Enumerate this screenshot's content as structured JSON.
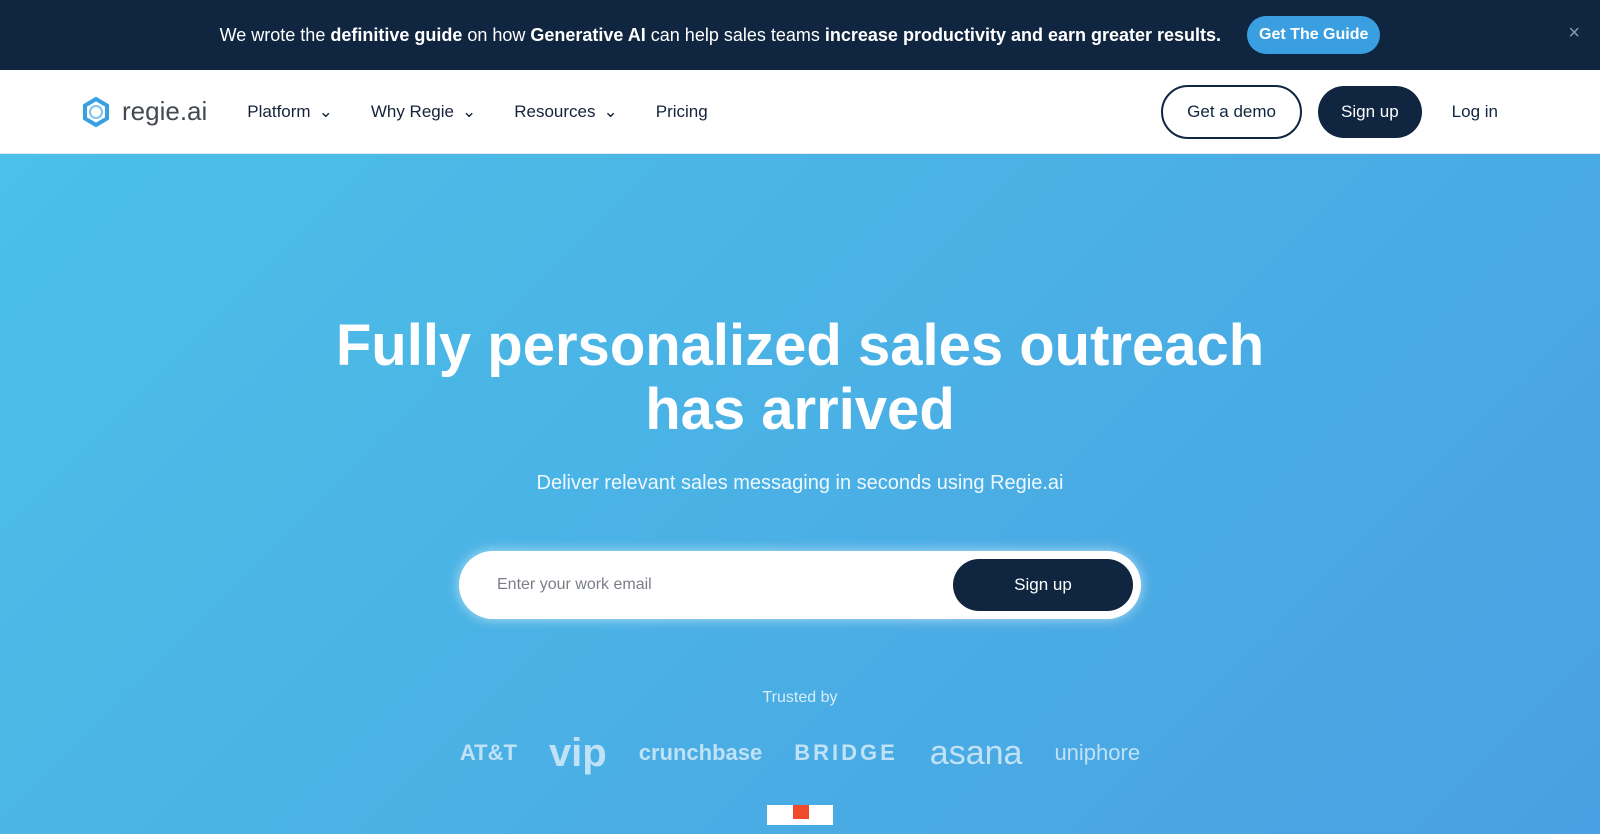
{
  "banner": {
    "pre": "We wrote the ",
    "b1": "definitive guide",
    "mid1": " on how ",
    "b2": "Generative AI",
    "mid2": " can help sales teams ",
    "b3": "increase productivity and earn greater results.",
    "cta": "Get The Guide",
    "close": "×"
  },
  "nav": {
    "logo": "regie.ai",
    "items": [
      {
        "label": "Platform",
        "dropdown": true
      },
      {
        "label": "Why Regie",
        "dropdown": true
      },
      {
        "label": "Resources",
        "dropdown": true
      },
      {
        "label": "Pricing",
        "dropdown": false
      }
    ],
    "demo": "Get a demo",
    "signup": "Sign up",
    "login": "Log in"
  },
  "hero": {
    "title_line1": "Fully personalized sales outreach",
    "title_line2": "has arrived",
    "subtitle": "Deliver relevant sales messaging in seconds using Regie.ai",
    "email_placeholder": "Enter your work email",
    "signup": "Sign up",
    "trusted": "Trusted by",
    "logos": [
      "AT&T",
      "vip",
      "crunchbase",
      "BRIDGE",
      "asana",
      "uniphore"
    ]
  },
  "colors": {
    "banner": "#0f2540",
    "accent": "#3a9fe0",
    "hero_start": "#4bc0e8",
    "hero_end": "#4aa0e2"
  }
}
